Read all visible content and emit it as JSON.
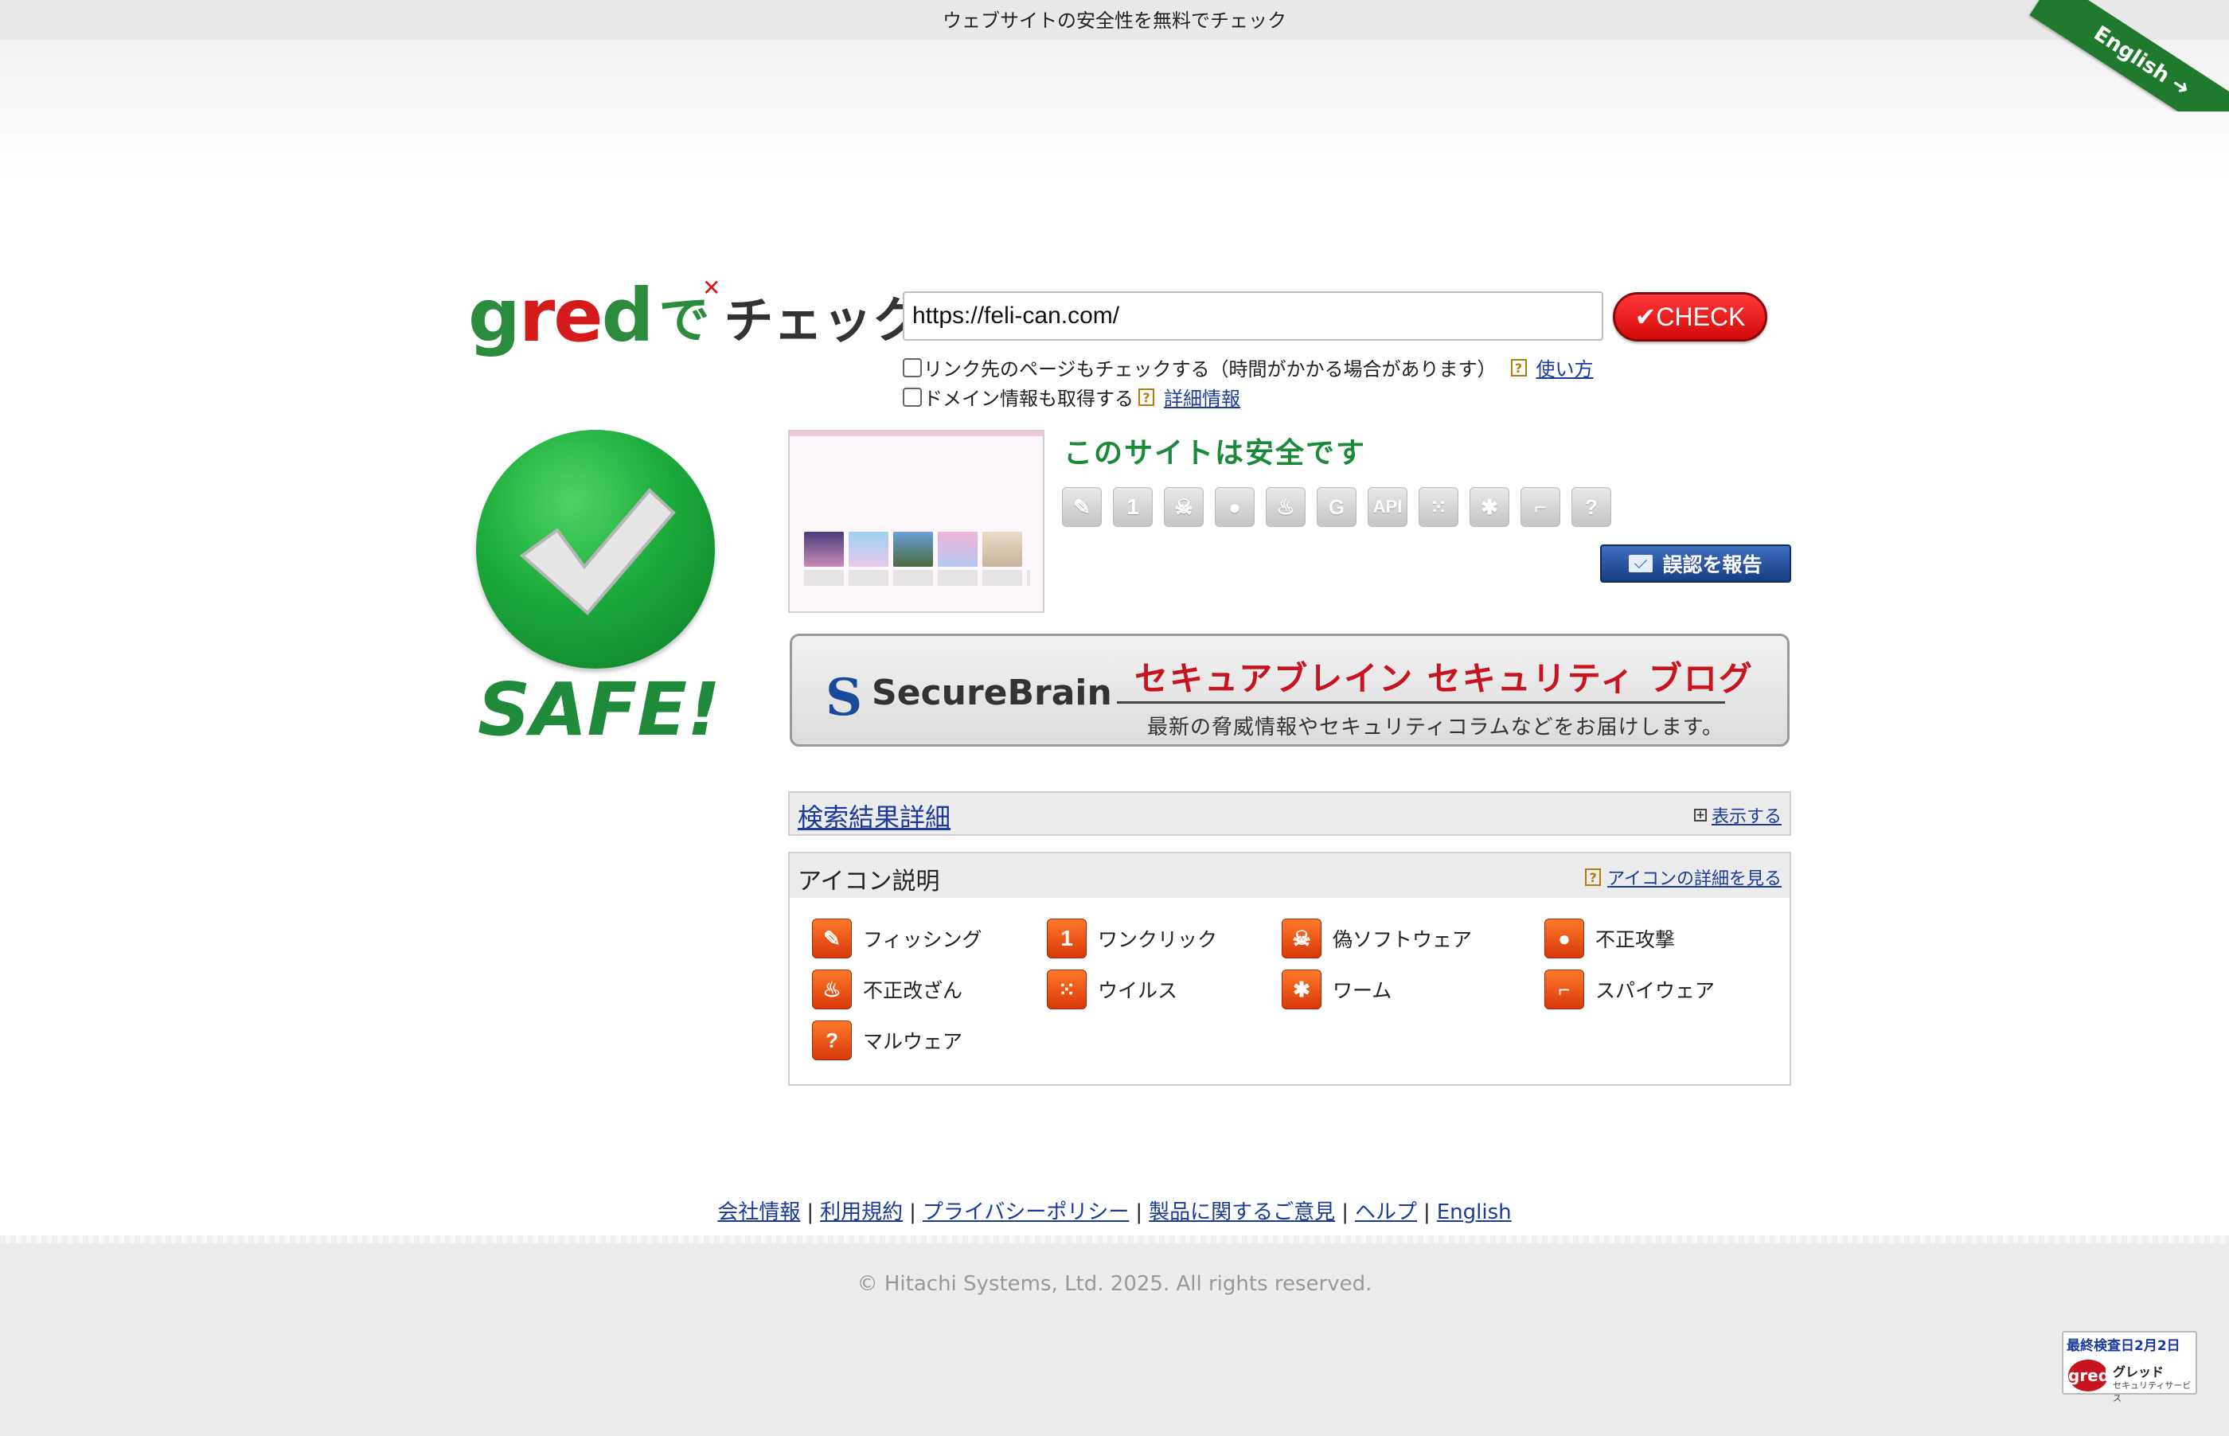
{
  "header": {
    "tagline": "ウェブサイトの安全性を無料でチェック",
    "ribbon_label": "English ➜"
  },
  "logo": {
    "text_gred": "gred",
    "text_de": "で",
    "text_check": "チェック"
  },
  "search": {
    "url_value": "https://feli-can.com/",
    "check_label": "✔CHECK",
    "option_links_text": "リンク先のページもチェックする（時間がかかる場合があります）",
    "option_links_help": "使い方",
    "option_domain_text": "ドメイン情報も取得する",
    "option_domain_help": "詳細情報"
  },
  "result": {
    "safe_text": "SAFE!",
    "status_text": "このサイトは安全です",
    "report_label": "誤認を報告",
    "icons": [
      "phishing-icon",
      "one-click-icon",
      "skull-icon",
      "bomb-icon",
      "fire-icon",
      "g-icon",
      "api-icon",
      "virus-icon",
      "worm-icon",
      "gun-icon",
      "question-icon"
    ]
  },
  "banner": {
    "brand": "SecureBrain",
    "title": "セキュアブレイン セキュリティ ブログ",
    "subtitle": "最新の脅威情報やセキュリティコラムなどをお届けします。"
  },
  "details": {
    "title": "検索結果詳細",
    "toggle_label": "表示する"
  },
  "legend": {
    "title": "アイコン説明",
    "details_link": "アイコンの詳細を見る",
    "items": [
      {
        "label": "フィッシング",
        "icon": "phishing-icon"
      },
      {
        "label": "ワンクリック",
        "icon": "one-click-icon"
      },
      {
        "label": "偽ソフトウェア",
        "icon": "skull-icon"
      },
      {
        "label": "不正攻撃",
        "icon": "bomb-icon"
      },
      {
        "label": "不正改ざん",
        "icon": "fire-icon"
      },
      {
        "label": "ウイルス",
        "icon": "virus-icon"
      },
      {
        "label": "ワーム",
        "icon": "worm-icon"
      },
      {
        "label": "スパイウェア",
        "icon": "gun-icon"
      },
      {
        "label": "マルウェア",
        "icon": "question-icon"
      }
    ]
  },
  "footer": {
    "links": [
      "会社情報",
      "利用規約",
      "プライバシーポリシー",
      "製品に関するご意見",
      "ヘルプ",
      "English"
    ],
    "copyright": "© Hitachi Systems, Ltd. 2025. All rights reserved.",
    "seal_date": "最終検査日2月2日",
    "seal_brand": "グレッド",
    "seal_sub": "セキュリティサービス",
    "seal_mark": "gred"
  }
}
